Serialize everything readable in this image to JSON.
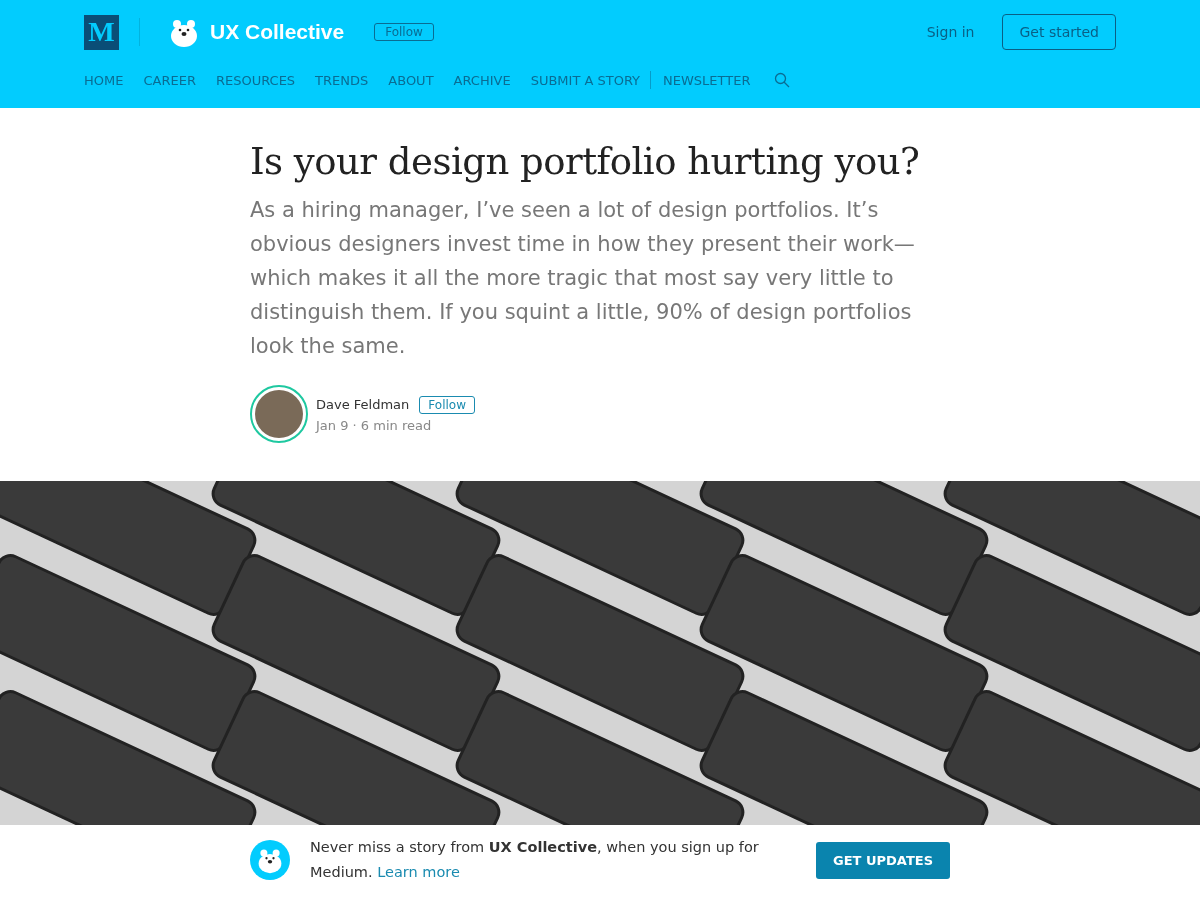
{
  "header": {
    "logo_letter": "M",
    "publication": "UX Collective",
    "follow": "Follow",
    "sign_in": "Sign in",
    "get_started": "Get started"
  },
  "nav": [
    {
      "label": "HOME",
      "divider_before": false
    },
    {
      "label": "CAREER",
      "divider_before": false
    },
    {
      "label": "RESOURCES",
      "divider_before": false
    },
    {
      "label": "TRENDS",
      "divider_before": false
    },
    {
      "label": "ABOUT",
      "divider_before": false
    },
    {
      "label": "ARCHIVE",
      "divider_before": false
    },
    {
      "label": "SUBMIT A STORY",
      "divider_before": false
    },
    {
      "label": "NEWSLETTER",
      "divider_before": true
    }
  ],
  "article": {
    "title": "Is your design portfolio hurting you?",
    "subtitle": "As a hiring manager, I’ve seen a lot of design portfolios. It’s obvious designers invest time in how they present their work—which makes it all the more tragic that most say very little to distinguish them. If you squint a little, 90% of design portfolios look the same.",
    "author": "Dave Feldman",
    "follow": "Follow",
    "meta": "Jan 9 · 6 min read"
  },
  "banner": {
    "text": "Never miss a story from **UX Collective**, when you sign up for Medium.",
    "link": "Learn more",
    "button": "GET UPDATES"
  }
}
